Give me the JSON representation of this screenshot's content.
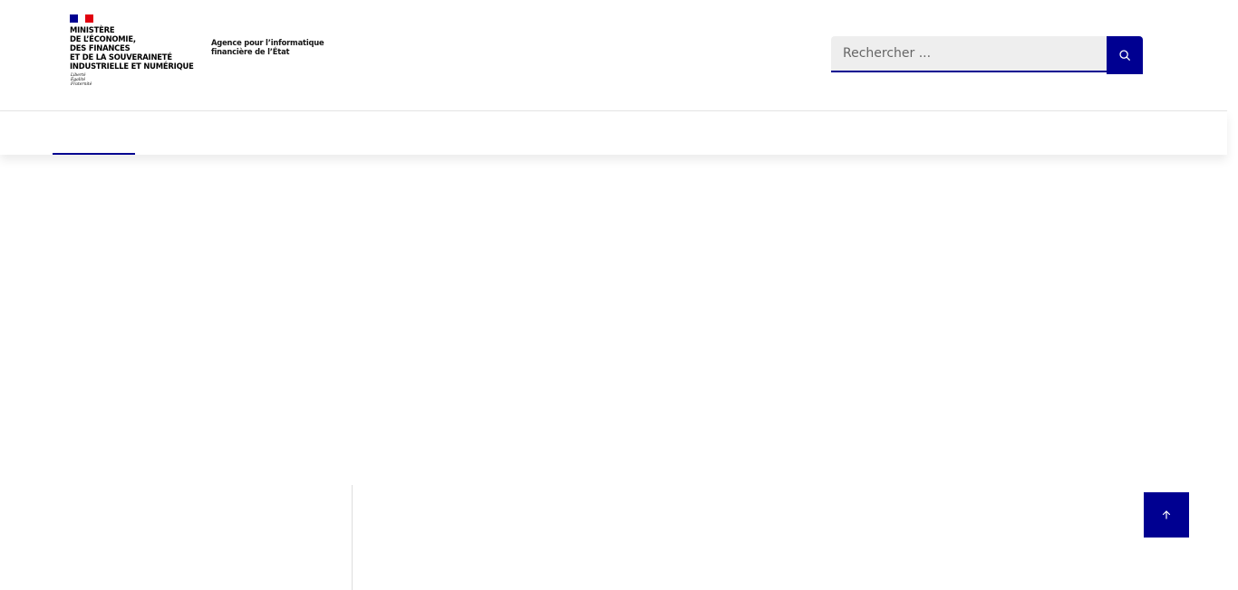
{
  "header": {
    "ministry_name": "MINISTÈRE\nDE L’ÉCONOMIE,\nDES FINANCES\nET DE LA SOUVERAINETÉ\nINDUSTRIELLE ET NUMÉRIQUE",
    "motto": "Liberté\nÉgalité\nFraternité",
    "agency_name": "Agence pour l’informatique\nfinancière de l’État",
    "flag_colors": [
      "#000091",
      "#ffffff",
      "#e1000f"
    ]
  },
  "search": {
    "placeholder": "Rechercher ...",
    "value": "",
    "button_icon": "search-icon"
  },
  "navigation": {
    "active_indicator_color": "#000091"
  },
  "footer": {
    "back_to_top_icon": "arrow-up-icon"
  },
  "colors": {
    "accent": "#000091",
    "search_bg": "#eeeeee"
  }
}
